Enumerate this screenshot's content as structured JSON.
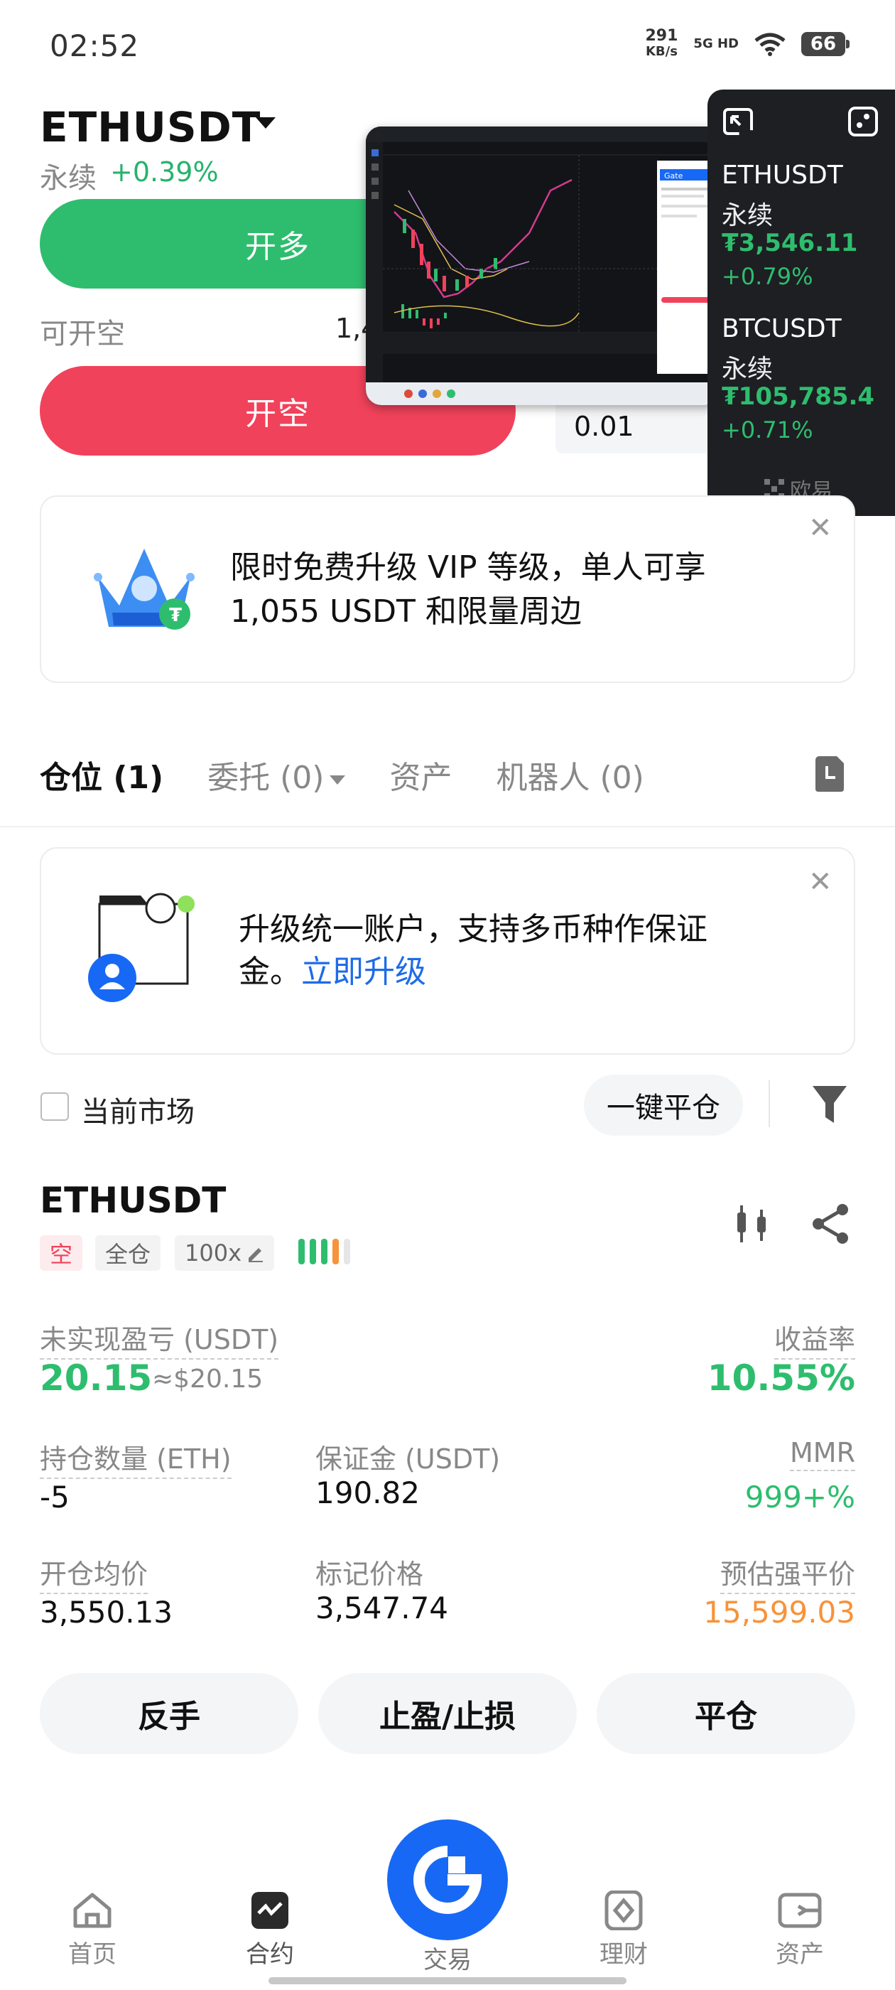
{
  "status_bar": {
    "time": "02:52",
    "net_speed": "291",
    "net_unit": "KB/s",
    "net_type": "5G HD",
    "battery": "66"
  },
  "header": {
    "symbol": "ETHUSDT",
    "type": "永续",
    "change": "+0.39%",
    "long_button": "开多",
    "can_short_label": "可开空",
    "can_short_value": "1,4",
    "short_button": "开空",
    "quantity": "0.01"
  },
  "ticker_panel": {
    "items": [
      {
        "symbol": "ETHUSDT",
        "type": "永续",
        "price": "₮3,546.11",
        "change": "+0.79%"
      },
      {
        "symbol": "BTCUSDT",
        "type": "永续",
        "price": "₮105,785.4",
        "change": "+0.71%"
      }
    ],
    "brand": "欧易"
  },
  "embedded_screenshot": {
    "app_badge": "Gate"
  },
  "vip_banner": {
    "line1": "限时免费升级 VIP 等级，单人可享",
    "line2": "1,055 USDT 和限量周边"
  },
  "tabs": [
    {
      "label": "仓位 (1)"
    },
    {
      "label": "委托 (0)"
    },
    {
      "label": "资产"
    },
    {
      "label": "机器人 (0)"
    }
  ],
  "upgrade_banner": {
    "line1": "升级统一账户，支持多币种作保证",
    "line2": "金。",
    "link": "立即升级"
  },
  "filters": {
    "current_market": "当前市场",
    "one_click_close": "一键平仓"
  },
  "position": {
    "symbol": "ETHUSDT",
    "side_tag": "空",
    "margin_tag": "全仓",
    "leverage_tag": "100x",
    "leverage_bar_colors": [
      "#2ebd6e",
      "#2ebd6e",
      "#2ebd6e",
      "#f7933a",
      "#e6e6e6"
    ],
    "unrealized_pnl_label": "未实现盈亏 (USDT)",
    "unrealized_pnl_value": "20.15",
    "unrealized_pnl_usd": "≈$20.15",
    "roe_label": "收益率",
    "roe_value": "10.55%",
    "size_label": "持仓数量 (ETH)",
    "size_value": "-5",
    "margin_label": "保证金 (USDT)",
    "margin_value": "190.82",
    "mmr_label": "MMR",
    "mmr_value": "999+%",
    "entry_label": "开仓均价",
    "entry_value": "3,550.13",
    "mark_label": "标记价格",
    "mark_value": "3,547.74",
    "liq_label": "预估强平价",
    "liq_value": "15,599.03"
  },
  "actions": {
    "reverse": "反手",
    "tp_sl": "止盈/止损",
    "close": "平仓"
  },
  "bottom_nav": [
    {
      "label": "首页",
      "icon": "home-icon"
    },
    {
      "label": "合约",
      "icon": "futures-icon"
    },
    {
      "label": "交易",
      "icon": "trade-icon"
    },
    {
      "label": "理财",
      "icon": "earn-icon"
    },
    {
      "label": "资产",
      "icon": "wallet-icon"
    }
  ],
  "colors": {
    "green": "#2ebd6e",
    "red": "#f1425b",
    "blue": "#1769f5",
    "orange": "#f7933a"
  }
}
